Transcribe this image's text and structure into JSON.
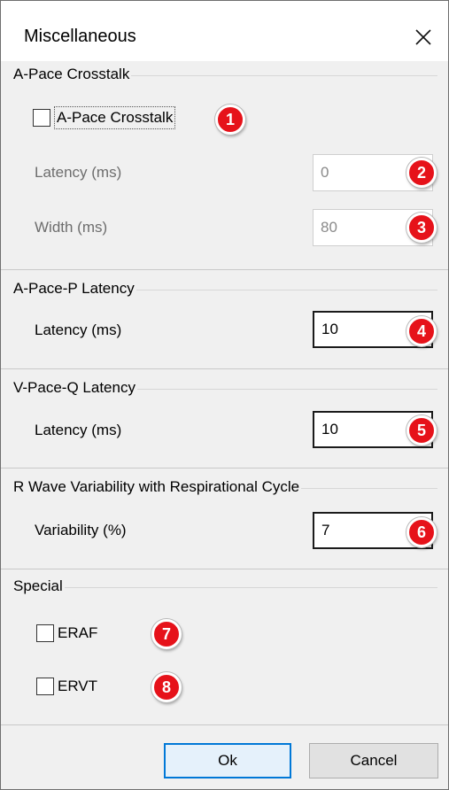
{
  "window": {
    "title": "Miscellaneous",
    "close_glyph": "✕"
  },
  "a_pace_crosstalk": {
    "legend": "A-Pace Crosstalk",
    "checkbox_label": "A-Pace Crosstalk",
    "checked": false,
    "latency_label": "Latency (ms)",
    "latency_value": "0",
    "width_label": "Width (ms)",
    "width_value": "80"
  },
  "a_pace_p_latency": {
    "legend": "A-Pace-P Latency",
    "latency_label": "Latency (ms)",
    "latency_value": "10"
  },
  "v_pace_q_latency": {
    "legend": "V-Pace-Q Latency",
    "latency_label": "Latency (ms)",
    "latency_value": "10"
  },
  "r_wave": {
    "legend": "R Wave Variability with Respirational Cycle",
    "variability_label": "Variability (%)",
    "variability_value": "7"
  },
  "special": {
    "legend": "Special",
    "eraf_label": "ERAF",
    "eraf_checked": false,
    "ervt_label": "ERVT",
    "ervt_checked": false
  },
  "badges": [
    "1",
    "2",
    "3",
    "4",
    "5",
    "6",
    "7",
    "8"
  ],
  "buttons": {
    "ok": "Ok",
    "cancel": "Cancel"
  },
  "colors": {
    "badge_red": "#e6121a",
    "focus_blue": "#0078d7"
  }
}
